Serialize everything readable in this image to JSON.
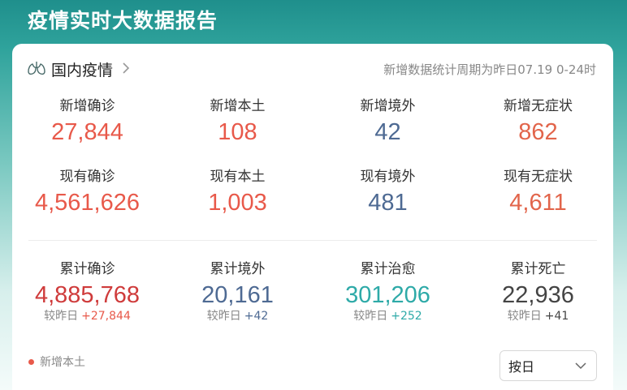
{
  "page": {
    "title": "疫情实时大数据报告"
  },
  "section": {
    "title": "国内疫情",
    "period_note": "新增数据统计周期为昨日07.19 0-24时"
  },
  "colors": {
    "confirmed": "#e8594a",
    "local": "#e8594a",
    "overseas": "#4e6a93",
    "asymptomatic": "#e2654b",
    "cumulative_confirmed": "#cf3b3b",
    "cumulative_overseas": "#4e6a93",
    "cured": "#2eaaa8",
    "death": "#444444"
  },
  "new_stats": [
    {
      "label": "新增确诊",
      "value": "27,844",
      "color": "#e8594a"
    },
    {
      "label": "新增本土",
      "value": "108",
      "color": "#e8594a"
    },
    {
      "label": "新增境外",
      "value": "42",
      "color": "#4e6a93"
    },
    {
      "label": "新增无症状",
      "value": "862",
      "color": "#e2654b"
    }
  ],
  "current_stats": [
    {
      "label": "现有确诊",
      "value": "4,561,626",
      "color": "#e8594a"
    },
    {
      "label": "现有本土",
      "value": "1,003",
      "color": "#e8594a"
    },
    {
      "label": "现有境外",
      "value": "481",
      "color": "#4e6a93"
    },
    {
      "label": "现有无症状",
      "value": "4,611",
      "color": "#e2654b"
    }
  ],
  "cumulative_stats": [
    {
      "label": "累计确诊",
      "value": "4,885,768",
      "color": "#cf3b3b",
      "delta_label": "较昨日",
      "delta": "+27,844",
      "delta_color": "#e8594a"
    },
    {
      "label": "累计境外",
      "value": "20,161",
      "color": "#4e6a93",
      "delta_label": "较昨日",
      "delta": "+42",
      "delta_color": "#4e6a93"
    },
    {
      "label": "累计治愈",
      "value": "301,206",
      "color": "#2eaaa8",
      "delta_label": "较昨日",
      "delta": "+252",
      "delta_color": "#2eaaa8"
    },
    {
      "label": "累计死亡",
      "value": "22,936",
      "color": "#444444",
      "delta_label": "较昨日",
      "delta": "+41",
      "delta_color": "#444444"
    }
  ],
  "legend": {
    "label": "新增本土",
    "color": "#e8594a"
  },
  "select": {
    "value": "按日"
  }
}
